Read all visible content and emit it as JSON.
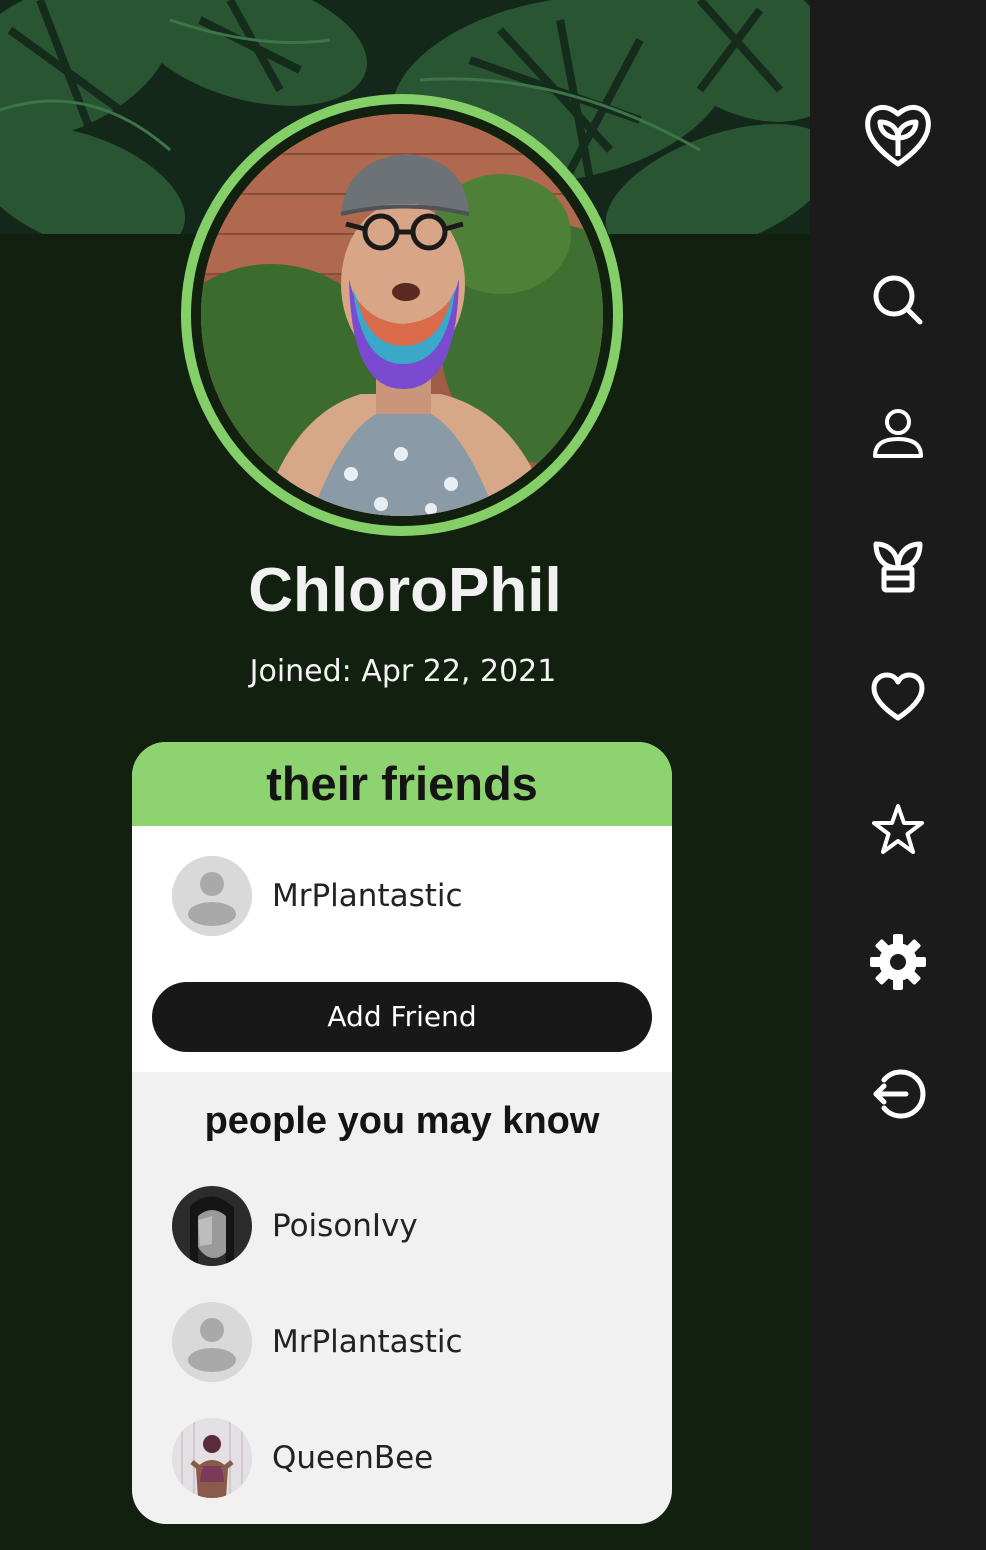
{
  "profile": {
    "username": "ChloroPhil",
    "joined": "Joined: Apr 22, 2021"
  },
  "friends": {
    "header": "their friends",
    "list": [
      {
        "name": "MrPlantastic",
        "avatar": "default-avatar"
      }
    ],
    "add_button": "Add Friend"
  },
  "suggestions": {
    "title": "people you may know",
    "list": [
      {
        "name": "PoisonIvy",
        "avatar": "photo"
      },
      {
        "name": "MrPlantastic",
        "avatar": "default-avatar"
      },
      {
        "name": "QueenBee",
        "avatar": "photo"
      }
    ]
  },
  "sidebar": {
    "items": [
      {
        "icon": "heart-leaf-logo-icon"
      },
      {
        "icon": "search-icon"
      },
      {
        "icon": "user-icon"
      },
      {
        "icon": "plant-pot-icon"
      },
      {
        "icon": "heart-icon"
      },
      {
        "icon": "star-icon"
      },
      {
        "icon": "gear-icon"
      },
      {
        "icon": "logout-icon"
      }
    ]
  },
  "colors": {
    "accent": "#8dd36f",
    "background": "#12200f",
    "sidebar": "#1b1b1b",
    "button": "#181818"
  }
}
